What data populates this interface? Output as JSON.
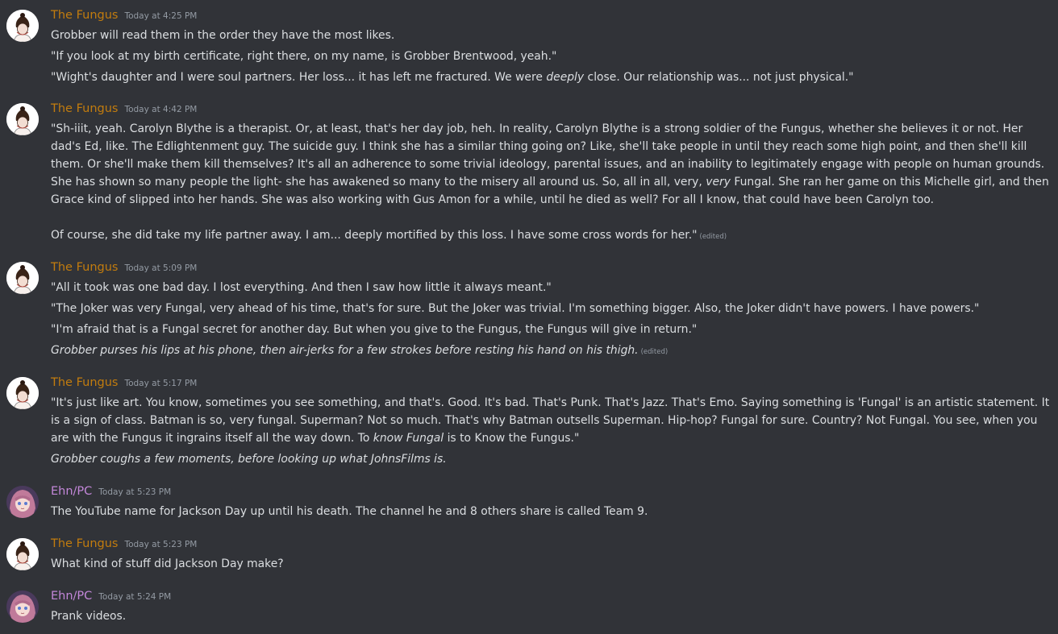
{
  "users": {
    "fungus": {
      "name": "The Fungus",
      "color": "#c27c0e"
    },
    "ehn": {
      "name": "Ehn/PC",
      "color": "#c387d9"
    }
  },
  "edited_label": "(edited)",
  "messages": [
    {
      "author": "The Fungus",
      "timestamp": "Today at 4:25 PM",
      "lines": [
        "Grobber will read them in the order they have the most likes.",
        "\"If you look at my birth certificate, right there, on my name, is Grobber Brentwood, yeah.\"",
        {
          "before": "\"Wight's daughter and I were soul partners. Her loss... it has left me fractured. We were ",
          "em": "deeply",
          "after": " close. Our relationship was... not just physical.\""
        }
      ]
    },
    {
      "author": "The Fungus",
      "timestamp": "Today at 4:42 PM",
      "para1_before": "\"Sh-iiit, yeah. Carolyn Blythe is a therapist. Or, at least, that's her day job, heh. In reality, Carolyn Blythe is a strong soldier of the Fungus, whether she believes it or not. Her dad's Ed, like. The Edlightenment guy. The suicide guy. I think she has a similar thing going on? Like, she'll take people in until they reach some high point, and then she'll kill them. Or she'll make them kill themselves? It's all an adherence to some trivial ideology, parental issues, and an inability to legitimately engage with people on human grounds. She has shown so many people the light- she has awakened so many to the misery all around us. So, all in all, very, ",
      "para1_em": "very",
      "para1_after": " Fungal. She ran her game on this Michelle girl, and then Grace kind of slipped into her hands. She was also working with Gus Amon for a while, until he died as well? For all I know, that could have been Carolyn too.",
      "para2": "Of course, she did take my life partner away. I am... deeply mortified by this loss. I have some cross words for her.\""
    },
    {
      "author": "The Fungus",
      "timestamp": "Today at 5:09 PM",
      "lines": [
        "\"All it took was one bad day. I lost everything. And then I saw how little it always meant.\"",
        "\"The Joker was very Fungal, very ahead of his time, that's for sure. But the Joker was trivial. I'm something bigger. Also, the Joker didn't have powers. I have powers.\"",
        "\"I'm afraid that is a Fungal secret for another day. But when you give to the Fungus, the Fungus will give in return.\"",
        "Grobber purses his lips at his phone, then air-jerks for a few strokes before resting his hand on his thigh."
      ]
    },
    {
      "author": "The Fungus",
      "timestamp": "Today at 5:17 PM",
      "para_before": "\"It's just like art. You know, sometimes you see something, and that's. Good. It's bad. That's Punk. That's Jazz. That's Emo. Saying something is 'Fungal' is an artistic statement. It is a sign of class. Batman is so, very fungal. Superman? Not so much. That's why Batman outsells Superman. Hip-hop? Fungal for sure. Country? Not Fungal. You see, when you are with the Fungus it ingrains itself all the way down. To ",
      "para_em": "know Fungal",
      "para_after": " is to Know the Fungus.\"",
      "action": "Grobber coughs a few moments, before looking up what JohnsFilms is."
    },
    {
      "author": "Ehn/PC",
      "timestamp": "Today at 5:23 PM",
      "lines": [
        "The YouTube name for Jackson Day up until his death. The channel he and 8 others share is called Team 9."
      ]
    },
    {
      "author": "The Fungus",
      "timestamp": "Today at 5:23 PM",
      "lines": [
        "What kind of stuff did Jackson Day make?"
      ]
    },
    {
      "author": "Ehn/PC",
      "timestamp": "Today at 5:24 PM",
      "lines": [
        "Prank videos."
      ]
    }
  ]
}
